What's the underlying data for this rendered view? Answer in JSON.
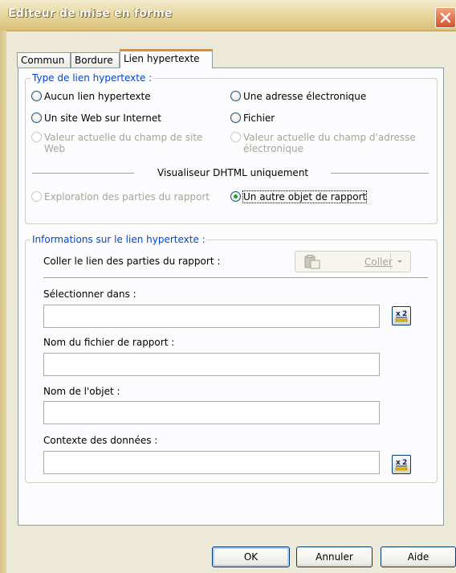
{
  "window": {
    "title": "Editeur de mise en forme"
  },
  "tabs": [
    {
      "label": "Commun"
    },
    {
      "label": "Bordure"
    },
    {
      "label": "Lien hypertexte"
    }
  ],
  "link_type": {
    "legend": "Type de lien hypertexte :",
    "options": {
      "none": "Aucun lien hypertexte",
      "email": "Une adresse électronique",
      "website": "Un site Web sur Internet",
      "file": "Fichier",
      "field_site_line1": "Valeur actuelle du champ de site",
      "field_site_line2": "Web",
      "field_email_line1": "Valeur actuelle du champ d'adresse",
      "field_email_line2": "électronique",
      "explore": "Exploration des parties du rapport",
      "other_object": "Un autre objet de rapport"
    },
    "dhtml_separator": "Visualiseur DHTML uniquement",
    "selected": "other_object"
  },
  "link_info": {
    "legend": "Informations sur le lien hypertexte :",
    "paste_label": "Coller le lien des parties du rapport :",
    "paste_button": "Coller",
    "select_in_label": "Sélectionner dans :",
    "select_in_value": "",
    "report_file_label": "Nom du fichier de rapport :",
    "report_file_value": "",
    "object_name_label": "Nom de l'objet :",
    "object_name_value": "",
    "data_context_label": "Contexte des données :",
    "data_context_value": ""
  },
  "buttons": {
    "ok": "OK",
    "cancel": "Annuler",
    "help": "Aide"
  },
  "icons": {
    "close": "close-icon",
    "formula": "formula-icon",
    "paste": "paste-icon",
    "dropdown": "chevron-down-icon"
  },
  "colors": {
    "accent": "#e68b2c",
    "legend_text": "#0046d5",
    "radio_dot": "#21a121",
    "close_button": "#d4532a"
  }
}
